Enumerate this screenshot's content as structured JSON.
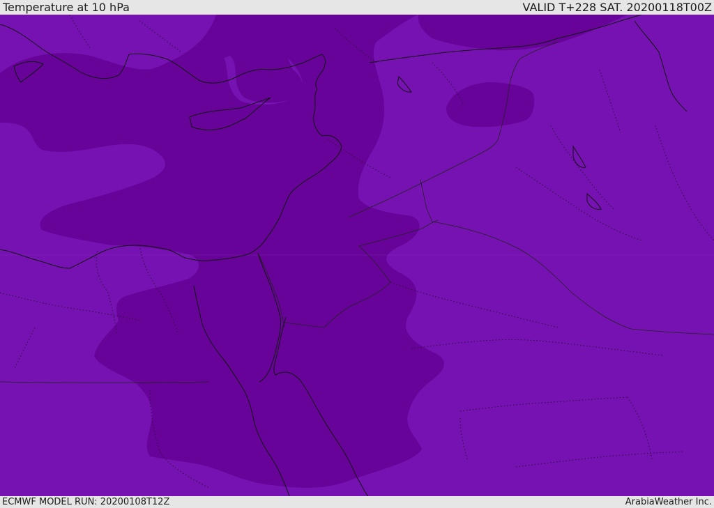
{
  "header": {
    "title": "Temperature at 10 hPa",
    "valid": "VALID T+228 SAT. 20200118T00Z"
  },
  "footer": {
    "model_run": "ECMWF MODEL RUN: 20200108T12Z",
    "credit": "ArabiaWeather Inc."
  },
  "colors": {
    "shade_light": "#7712b2",
    "shade_dark": "#68039a",
    "background": "#e6e6e6"
  }
}
